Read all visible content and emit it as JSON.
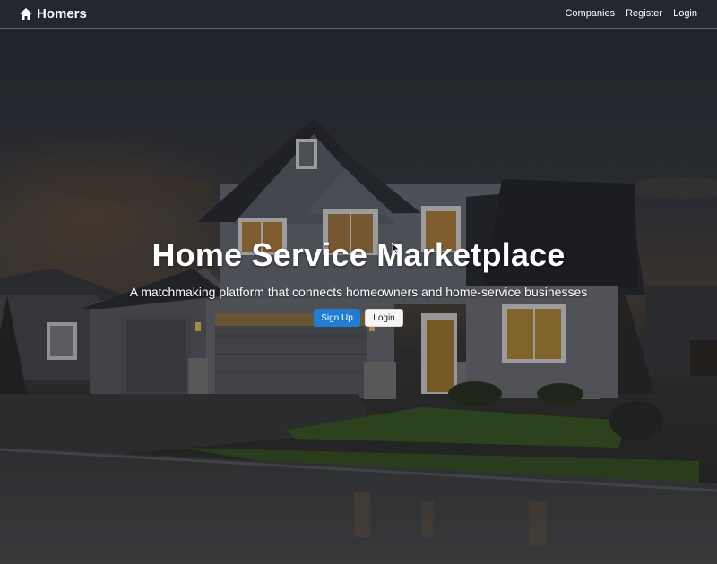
{
  "navbar": {
    "brand_label": "Homers",
    "brand_icon": "home-icon",
    "links": [
      {
        "label": "Companies"
      },
      {
        "label": "Register"
      },
      {
        "label": "Login"
      }
    ]
  },
  "hero": {
    "title": "Home Service Marketplace",
    "subtitle": "A matchmaking platform that connects homeowners and home-service businesses",
    "signup_label": "Sign Up",
    "login_label": "Login"
  },
  "colors": {
    "primary": "#1f7ed4",
    "light_button": "#f5f5f5",
    "text": "#ffffff"
  }
}
